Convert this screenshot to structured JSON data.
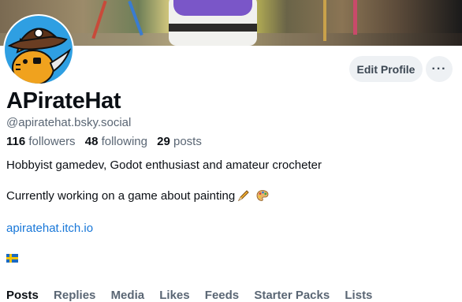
{
  "profile": {
    "display_name": "APirateHat",
    "handle": "@apiratehat.bsky.social",
    "bio_line1": "Hobbyist gamedev, Godot enthusiast and amateur crocheter",
    "bio_line2": "Currently working on a game about painting",
    "link": "apiratehat.itch.io",
    "bio_emojis": [
      "pencil-icon",
      "palette-icon"
    ],
    "flag": "sweden-flag-icon"
  },
  "stats": {
    "followers_count": "116",
    "followers_label": "followers",
    "following_count": "48",
    "following_label": "following",
    "posts_count": "29",
    "posts_label": "posts"
  },
  "actions": {
    "edit_profile_label": "Edit Profile",
    "more_label": "···"
  },
  "tabs": [
    "Posts",
    "Replies",
    "Media",
    "Likes",
    "Feeds",
    "Starter Packs",
    "Lists"
  ],
  "colors": {
    "accent": "#1877d8",
    "muted_text": "#5a6674",
    "button_bg": "#eef1f4",
    "avatar_bg": "#2f9fe2"
  }
}
